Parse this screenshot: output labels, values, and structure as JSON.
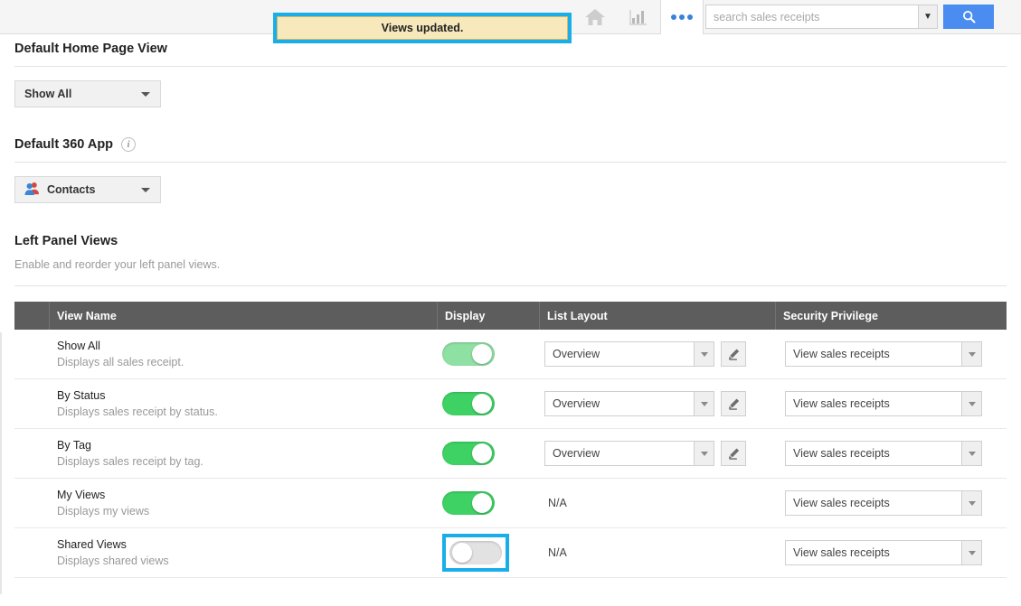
{
  "topbar": {
    "home_icon": "home-icon",
    "reports_icon": "bar-chart-icon",
    "more_icon": "ellipsis-icon",
    "search": {
      "placeholder": "search sales receipts",
      "value": "",
      "dropdown_icon": "chevron-down-icon",
      "button_icon": "search-icon"
    }
  },
  "notification": {
    "message": "Views updated."
  },
  "sections": {
    "home_view": {
      "title": "Default Home Page View",
      "selected": "Show All"
    },
    "app360": {
      "title": "Default 360 App",
      "info_icon": "info-icon",
      "selected": "Contacts",
      "app_icon": "contacts-icon"
    },
    "left_panel": {
      "title": "Left Panel Views",
      "description": "Enable and reorder your left panel views."
    }
  },
  "table": {
    "columns": [
      "",
      "View Name",
      "Display",
      "List Layout",
      "Security Privilege"
    ],
    "na_label": "N/A",
    "edit_icon": "pencil-icon",
    "rows": [
      {
        "name": "Show All",
        "description": "Displays all sales receipt.",
        "display_on": true,
        "display_muted": true,
        "display_highlighted": false,
        "layout": "Overview",
        "has_layout_select": true,
        "has_edit": true,
        "privilege": "View sales receipts"
      },
      {
        "name": "By Status",
        "description": "Displays sales receipt by status.",
        "display_on": true,
        "display_muted": false,
        "display_highlighted": false,
        "layout": "Overview",
        "has_layout_select": true,
        "has_edit": true,
        "privilege": "View sales receipts"
      },
      {
        "name": "By Tag",
        "description": "Displays sales receipt by tag.",
        "display_on": true,
        "display_muted": false,
        "display_highlighted": false,
        "layout": "Overview",
        "has_layout_select": true,
        "has_edit": true,
        "privilege": "View sales receipts"
      },
      {
        "name": "My Views",
        "description": "Displays my views",
        "display_on": true,
        "display_muted": false,
        "display_highlighted": false,
        "layout": "N/A",
        "has_layout_select": false,
        "has_edit": false,
        "privilege": "View sales receipts"
      },
      {
        "name": "Shared Views",
        "description": "Displays shared views",
        "display_on": false,
        "display_muted": false,
        "display_highlighted": true,
        "layout": "N/A",
        "has_layout_select": false,
        "has_edit": false,
        "privilege": "View sales receipts"
      }
    ]
  },
  "colors": {
    "accent_highlight": "#19aee8",
    "toggle_on": "#3ed264",
    "toggle_on_muted": "#8fe0a3",
    "toggle_off": "#e2e2e2",
    "header_bg": "#5e5d5d",
    "notification_bg": "#f7e9bb",
    "search_button": "#4a8cf0"
  }
}
